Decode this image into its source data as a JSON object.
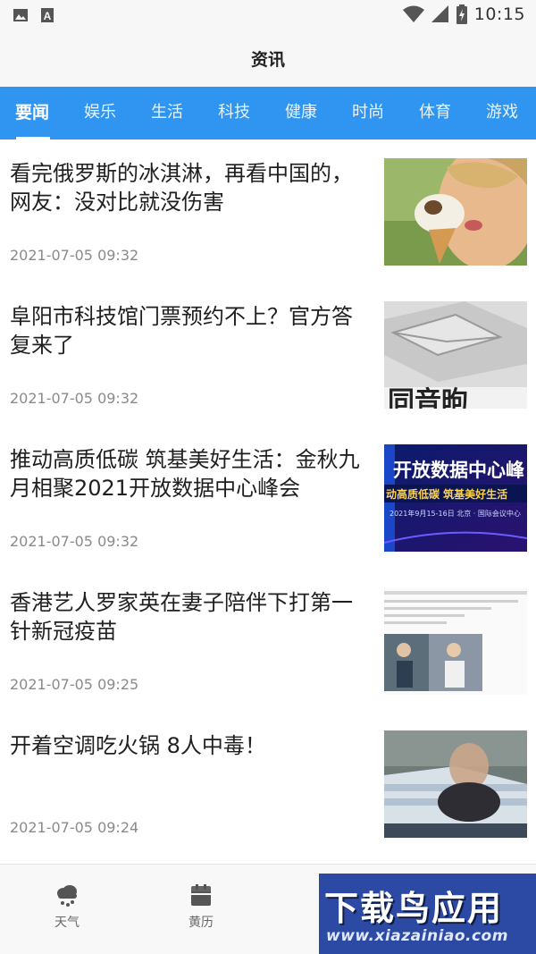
{
  "status_bar": {
    "time": "10:15",
    "left_icons": [
      "image-icon",
      "a-badge-icon"
    ],
    "right_icons": [
      "wifi-icon",
      "signal-icon",
      "battery-charging-icon"
    ]
  },
  "header": {
    "title": "资讯"
  },
  "tabs": {
    "active_color": "#2f95f0",
    "items": [
      {
        "label": "要闻",
        "active": true
      },
      {
        "label": "娱乐",
        "active": false
      },
      {
        "label": "生活",
        "active": false
      },
      {
        "label": "科技",
        "active": false
      },
      {
        "label": "健康",
        "active": false
      },
      {
        "label": "时尚",
        "active": false
      },
      {
        "label": "体育",
        "active": false
      },
      {
        "label": "游戏",
        "active": false
      }
    ]
  },
  "news": [
    {
      "title": "看完俄罗斯的冰淇淋，再看中国的，网友：没对比就没伤害",
      "time": "2021-07-05 09:32"
    },
    {
      "title": "阜阳市科技馆门票预约不上？官方答复来了",
      "time": "2021-07-05 09:32",
      "thumb_text": "同音昫"
    },
    {
      "title": "推动高质低碳 筑基美好生活：金秋九月相聚2021开放数据中心峰会",
      "time": "2021-07-05 09:32",
      "thumb_text": "开放数据中心峰",
      "thumb_sub": "动高质低碳  筑基美好生活",
      "thumb_date": "2021年9月15-16日  北京 · 国际会议中心"
    },
    {
      "title": "香港艺人罗家英在妻子陪伴下打第一针新冠疫苗",
      "time": "2021-07-05 09:25"
    },
    {
      "title": "开着空调吃火锅 8人中毒！",
      "time": "2021-07-05 09:24"
    }
  ],
  "bottom_nav": {
    "items": [
      {
        "label": "天气",
        "icon": "weather-cloud-icon"
      },
      {
        "label": "黄历",
        "icon": "calendar-icon"
      }
    ]
  },
  "watermark": {
    "main": "下载鸟应用",
    "sub": "www.xiazainiao.com"
  }
}
